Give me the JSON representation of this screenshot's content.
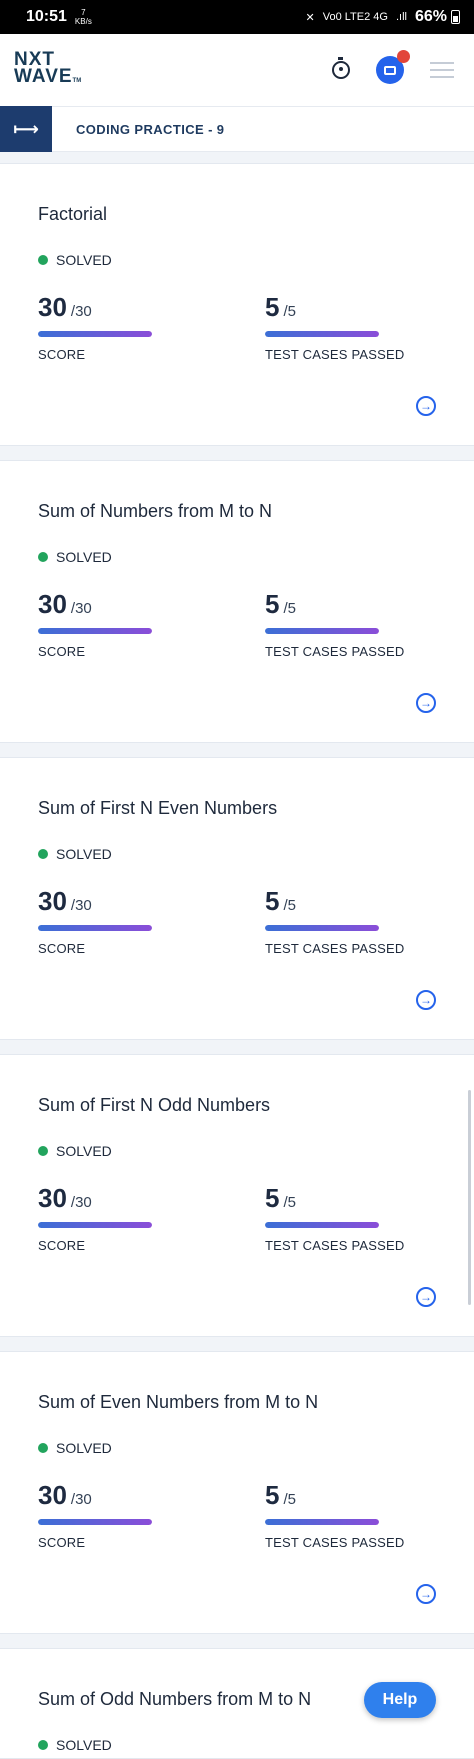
{
  "statusbar": {
    "time": "10:51",
    "speed": "7",
    "speed_unit": "KB/s",
    "network": "Vo0 LTE2 4G",
    "signal": ".ıll",
    "battery": "66%"
  },
  "header": {
    "logo_line1": "NXT",
    "logo_line2": "WAVE",
    "logo_tm": "TM"
  },
  "subheader": {
    "back_icon": "⟼",
    "title": "CODING PRACTICE - 9"
  },
  "problems": [
    {
      "title": "Factorial",
      "status": "SOLVED",
      "score": "30",
      "score_total": "/30",
      "score_label": "SCORE",
      "score_progress": 1.0,
      "tests": "5",
      "tests_total": "/5",
      "tests_label": "TEST CASES PASSED",
      "tests_progress": 1.0
    },
    {
      "title": "Sum of Numbers from M to N",
      "status": "SOLVED",
      "score": "30",
      "score_total": "/30",
      "score_label": "SCORE",
      "score_progress": 1.0,
      "tests": "5",
      "tests_total": "/5",
      "tests_label": "TEST CASES PASSED",
      "tests_progress": 1.0
    },
    {
      "title": "Sum of First N Even Numbers",
      "status": "SOLVED",
      "score": "30",
      "score_total": "/30",
      "score_label": "SCORE",
      "score_progress": 1.0,
      "tests": "5",
      "tests_total": "/5",
      "tests_label": "TEST CASES PASSED",
      "tests_progress": 1.0
    },
    {
      "title": "Sum of First N Odd Numbers",
      "status": "SOLVED",
      "score": "30",
      "score_total": "/30",
      "score_label": "SCORE",
      "score_progress": 1.0,
      "tests": "5",
      "tests_total": "/5",
      "tests_label": "TEST CASES PASSED",
      "tests_progress": 1.0
    },
    {
      "title": "Sum of Even Numbers from M to N",
      "status": "SOLVED",
      "score": "30",
      "score_total": "/30",
      "score_label": "SCORE",
      "score_progress": 1.0,
      "tests": "5",
      "tests_total": "/5",
      "tests_label": "TEST CASES PASSED",
      "tests_progress": 1.0
    },
    {
      "title": "Sum of Odd Numbers from M to N",
      "status": "SOLVED"
    }
  ],
  "help_label": "Help",
  "colors": {
    "accent": "#2563eb",
    "navy": "#1d3c6e",
    "solved": "#22a45d",
    "bar_start": "#3b6fd6",
    "bar_end": "#8b4dd8",
    "notification": "#e2453a"
  },
  "icons": [
    "stopwatch-icon",
    "chat-icon",
    "hamburger-icon",
    "back-arrow-icon",
    "arrow-right-circle-icon"
  ]
}
